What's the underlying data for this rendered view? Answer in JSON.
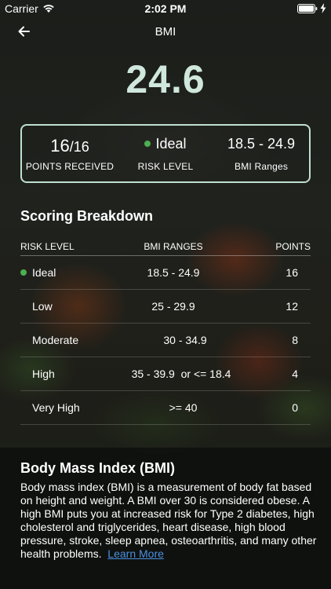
{
  "status_bar": {
    "carrier": "Carrier",
    "time": "2:02 PM"
  },
  "nav": {
    "title": "BMI"
  },
  "bmi_value": "24.6",
  "summary": {
    "points_value": "16",
    "points_total": "/16",
    "points_label": "POINTS RECEIVED",
    "risk_value": "Ideal",
    "risk_label": "RISK LEVEL",
    "range_value": "18.5 - 24.9",
    "range_label": "BMI Ranges"
  },
  "breakdown": {
    "title": "Scoring Breakdown",
    "headers": {
      "risk": "RISK LEVEL",
      "range": "BMI RANGES",
      "points": "POINTS"
    },
    "rows": [
      {
        "risk": "Ideal",
        "range": "18.5 - 24.9",
        "points": "16"
      },
      {
        "risk": "Low",
        "range": "25 - 29.9",
        "points": "12"
      },
      {
        "risk": "Moderate",
        "range": "30 - 34.9",
        "points": "8"
      },
      {
        "risk": "High",
        "range": "35 - 39.9  or <= 18.4",
        "points": "4"
      },
      {
        "risk": "Very High",
        "range": ">= 40",
        "points": "0"
      }
    ]
  },
  "about": {
    "title": "Body Mass Index (BMI)",
    "text": "Body mass index (BMI) is a measurement of body fat based on height and weight.  A BMI over 30 is considered obese.  A high BMI puts you at increased risk for Type 2 diabetes, high cholesterol and triglycerides, heart disease, high blood pressure, stroke, sleep apnea, osteoarthritis,  and many other health problems.",
    "link": "Learn More"
  },
  "colors": {
    "accent": "#cfe7dc",
    "indicator": "#4caf50",
    "link": "#4a90e2"
  }
}
